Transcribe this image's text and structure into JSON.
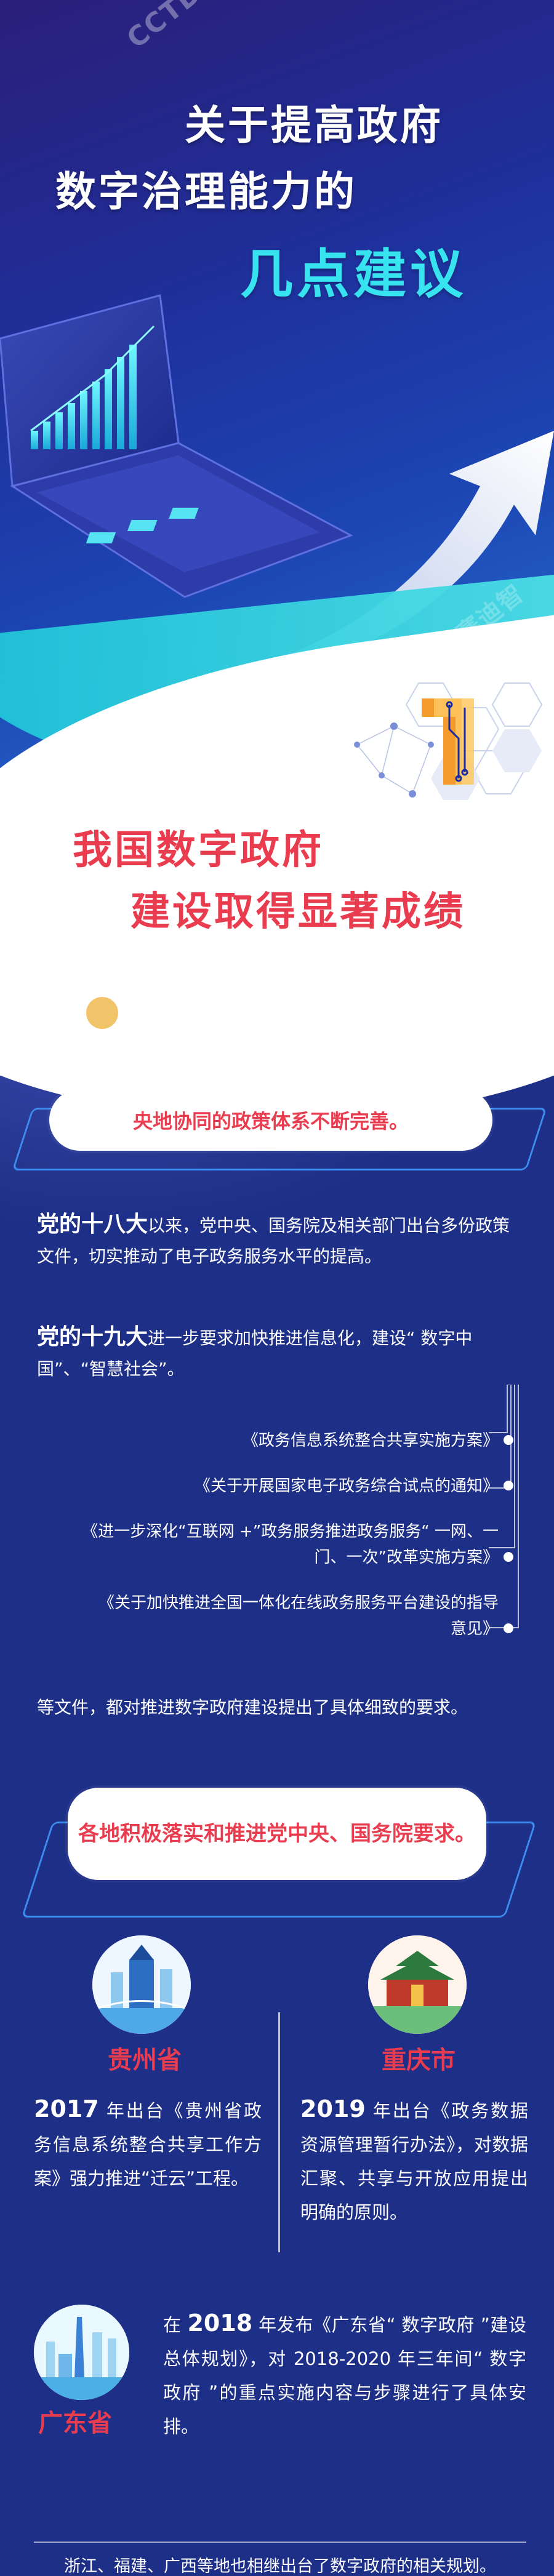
{
  "hero": {
    "watermark": "CCTD 赛迪智库",
    "title_line1": "关于提高政府",
    "title_line2": "数字治理能力的",
    "title_line3": "几点建议",
    "section_number": "1"
  },
  "section1": {
    "title_line1": "我国数字政府",
    "title_line2": "建设取得显著成绩"
  },
  "block1": {
    "pill": "央地协同的政策体系不断完善。",
    "para1_bold": "党的十八大",
    "para1_rest": "以来，党中央、国务院及相关部门出台多份政策文件，切实推动了电子政务服务水平的提高。",
    "para2_bold": "党的十九大",
    "para2_rest": "进一步要求加快推进信息化，建设“ 数字中国”、“智慧社会”。",
    "docs": [
      "《政务信息系统整合共享实施方案》",
      "《关于开展国家电子政务综合试点的通知》",
      "《进一步深化“互联网 +”政务服务推进政务服务“ 一网、一门、一次”改革实施方案》",
      "《关于加快推进全国一体化在线政务服务平台建设的指导意见》"
    ],
    "para3": "等文件，都对推进数字政府建设提出了具体细致的要求。"
  },
  "block2": {
    "pill": "各地积极落实和推进党中央、国务院要求。",
    "guizhou": {
      "name": "贵州省",
      "year": "2017",
      "text": " 年出台《贵州省政务信息系统整合共享工作方案》强力推进“迁云”工程。"
    },
    "chongqing": {
      "name": "重庆市",
      "year": "2019",
      "text": " 年出台《政务数据资源管理暂行办法》，对数据汇聚、共享与开放应用提出明确的原则。"
    },
    "guangdong": {
      "name": "广东省",
      "pre": "在 ",
      "year": "2018",
      "text": " 年发布《广东省“ 数字政府 ”建设总体规划》，对 2018-2020 年三年间“ 数字政府 ”的重点实施内容与步骤进行了具体安排。"
    },
    "bottom": "浙江、福建、广西等地也相继出台了数字政府的相关规划。"
  },
  "colors": {
    "accent_red": "#ea3c4f",
    "body_blue": "#1d2f87",
    "cyan": "#37e3ee"
  }
}
